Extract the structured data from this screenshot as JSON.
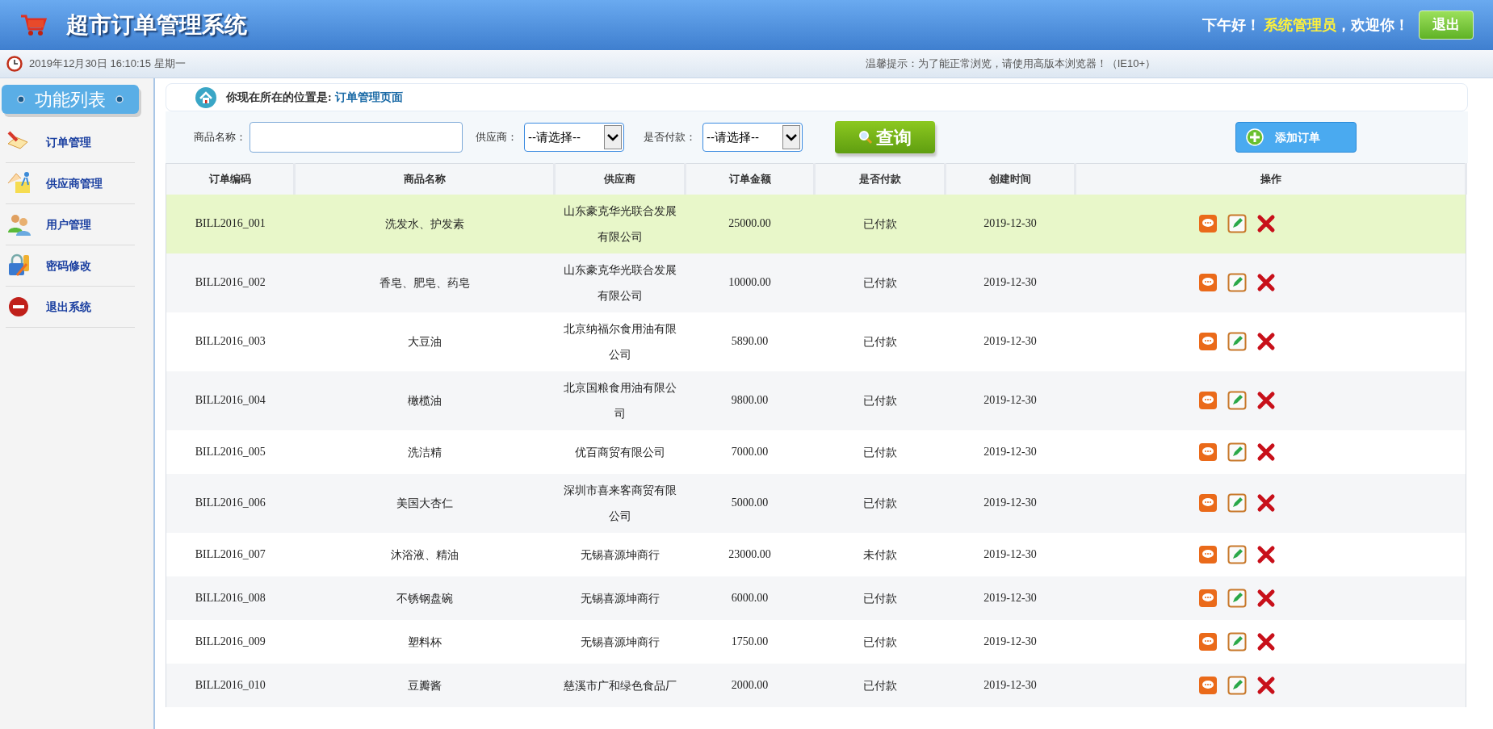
{
  "header": {
    "title": "超市订单管理系统",
    "greeting": "下午好！",
    "user": "系统管理员",
    "welcome": "，欢迎你！",
    "logout": "退出"
  },
  "info_bar": {
    "datetime": "2019年12月30日 16:10:15 星期一",
    "tip": "温馨提示：为了能正常浏览，请使用高版本浏览器！（IE10+）"
  },
  "sidebar": {
    "title": "功能列表",
    "items": [
      {
        "label": "订单管理",
        "kind": "order"
      },
      {
        "label": "供应商管理",
        "kind": "supplier"
      },
      {
        "label": "用户管理",
        "kind": "user"
      },
      {
        "label": "密码修改",
        "kind": "password"
      },
      {
        "label": "退出系统",
        "kind": "exit"
      }
    ]
  },
  "breadcrumb": {
    "prefix": "你现在所在的位置是:",
    "current": "订单管理页面"
  },
  "search": {
    "name_label": "商品名称：",
    "supplier_label": "供应商：",
    "supplier_value": "--请选择--",
    "paid_label": "是否付款：",
    "paid_value": "--请选择--",
    "query": "查询",
    "add": "添加订单"
  },
  "table": {
    "columns": [
      "订单编码",
      "商品名称",
      "供应商",
      "订单金额",
      "是否付款",
      "创建时间",
      "操作"
    ],
    "rows": [
      {
        "code": "BILL2016_001",
        "product": "洗发水、护发素",
        "supplier": "山东豪克华光联合发展有限公司",
        "amount": "25000.00",
        "paid": "已付款",
        "created": "2019-12-30",
        "selected": true
      },
      {
        "code": "BILL2016_002",
        "product": "香皂、肥皂、药皂",
        "supplier": "山东豪克华光联合发展有限公司",
        "amount": "10000.00",
        "paid": "已付款",
        "created": "2019-12-30",
        "selected": false
      },
      {
        "code": "BILL2016_003",
        "product": "大豆油",
        "supplier": "北京纳福尔食用油有限公司",
        "amount": "5890.00",
        "paid": "已付款",
        "created": "2019-12-30",
        "selected": false
      },
      {
        "code": "BILL2016_004",
        "product": "橄榄油",
        "supplier": "北京国粮食用油有限公司",
        "amount": "9800.00",
        "paid": "已付款",
        "created": "2019-12-30",
        "selected": false
      },
      {
        "code": "BILL2016_005",
        "product": "洗洁精",
        "supplier": "优百商贸有限公司",
        "amount": "7000.00",
        "paid": "已付款",
        "created": "2019-12-30",
        "selected": false
      },
      {
        "code": "BILL2016_006",
        "product": "美国大杏仁",
        "supplier": "深圳市喜来客商贸有限公司",
        "amount": "5000.00",
        "paid": "已付款",
        "created": "2019-12-30",
        "selected": false
      },
      {
        "code": "BILL2016_007",
        "product": "沐浴液、精油",
        "supplier": "无锡喜源坤商行",
        "amount": "23000.00",
        "paid": "未付款",
        "created": "2019-12-30",
        "selected": false
      },
      {
        "code": "BILL2016_008",
        "product": "不锈钢盘碗",
        "supplier": "无锡喜源坤商行",
        "amount": "6000.00",
        "paid": "已付款",
        "created": "2019-12-30",
        "selected": false
      },
      {
        "code": "BILL2016_009",
        "product": "塑料杯",
        "supplier": "无锡喜源坤商行",
        "amount": "1750.00",
        "paid": "已付款",
        "created": "2019-12-30",
        "selected": false
      },
      {
        "code": "BILL2016_010",
        "product": "豆瓣酱",
        "supplier": "慈溪市广和绿色食品厂",
        "amount": "2000.00",
        "paid": "已付款",
        "created": "2019-12-30",
        "selected": false
      }
    ]
  }
}
